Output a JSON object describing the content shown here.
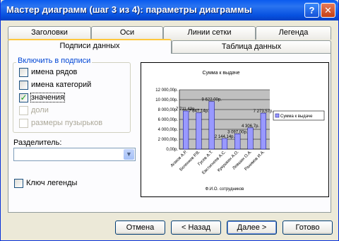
{
  "window": {
    "title": "Мастер диаграмм (шаг 3 из 4): параметры диаграммы",
    "help_label": "?",
    "close_label": "✕"
  },
  "tabs_top": [
    "Заголовки",
    "Оси",
    "Линии сетки",
    "Легенда"
  ],
  "tabs_bottom": [
    "Подписи данных",
    "Таблица данных"
  ],
  "include": {
    "legend": "Включить в подписи",
    "items": [
      {
        "label": "имена рядов",
        "checked": false,
        "disabled": false
      },
      {
        "label": "имена категорий",
        "checked": false,
        "disabled": false
      },
      {
        "label": "значения",
        "checked": true,
        "disabled": false
      },
      {
        "label": "доли",
        "checked": false,
        "disabled": true
      },
      {
        "label": "размеры пузырьков",
        "checked": false,
        "disabled": true
      }
    ]
  },
  "separator": {
    "label": "Разделитель:",
    "value": ""
  },
  "legend_key": {
    "label": "Ключ легенды",
    "checked": false
  },
  "buttons": {
    "cancel": "Отмена",
    "back": "< Назад",
    "next": "Далее >",
    "finish": "Готово"
  },
  "chart_data": {
    "type": "bar",
    "title": "Сумма к выдаче",
    "xlabel": "Ф.И.О. сотрудников",
    "ylabel": "",
    "categories": [
      "Агаков А.Р.",
      "Беленков Р.В.",
      "Гусев А.Т.",
      "Евстигнеев А.С.",
      "Кукушкин А.О.",
      "Левшин О.А.",
      "Рахимов И.А."
    ],
    "series": [
      {
        "name": "Сумма к выдаче",
        "values": [
          7711.43,
          7347.14,
          9622.0,
          2144.14,
          3097.0,
          4306.7,
          7273.57
        ]
      }
    ],
    "value_labels": [
      "7 711,43р.",
      "7 347,14р.",
      "9 622,00р.",
      "2 144,14р.",
      "3 097,00р.",
      "4 306,7р.",
      "7 273,57р."
    ],
    "ylim": [
      0,
      12000
    ],
    "ytick_labels": [
      "12 000,00р.",
      "10 000,00р.",
      "8 000,00р.",
      "6 000,00р.",
      "4 000,00р.",
      "2 000,00р.",
      "0,00р."
    ],
    "grid": true,
    "legend_position": "right",
    "colors": {
      "bar": "#9999ff",
      "bar_edge": "#000080",
      "plot_bg": "#c0c0c0"
    }
  }
}
